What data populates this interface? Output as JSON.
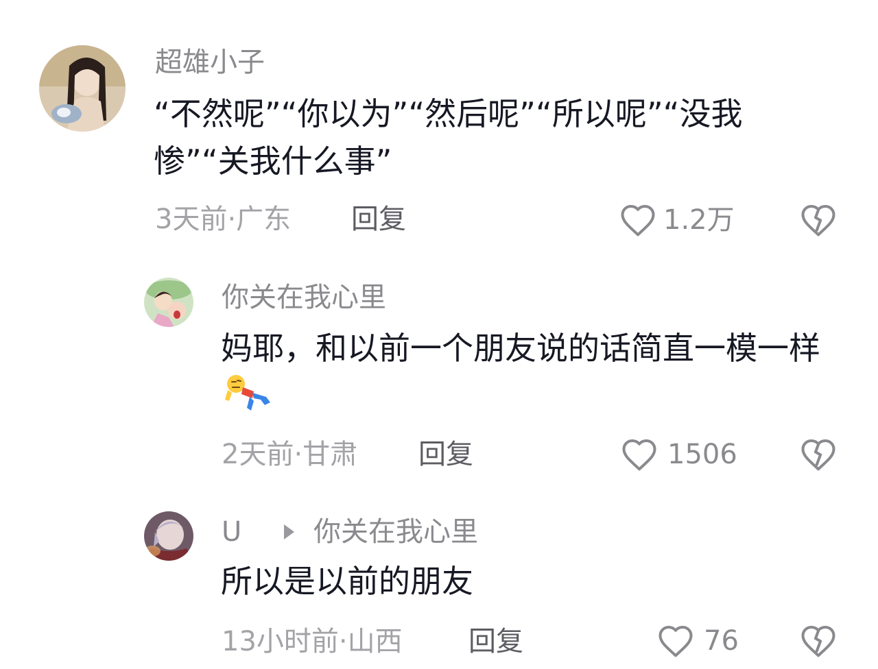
{
  "comments": [
    {
      "username": "超雄小子",
      "text": "“不然呢”“你以为”“然后呢”“所以呢”“没我惨”“关我什么事”",
      "time_location": "3天前·广东",
      "reply_label": "回复",
      "likes": "1.2万"
    },
    {
      "username": "你关在我心里",
      "text": "妈耶，和以前一个朋友说的话简直一模一样",
      "time_location": "2天前·甘肃",
      "reply_label": "回复",
      "likes": "1506"
    },
    {
      "username": "U",
      "reply_to": "你关在我心里",
      "text": "所以是以前的朋友",
      "time_location": "13小时前·山西",
      "reply_label": "回复",
      "likes": "76"
    }
  ],
  "icons": {
    "like": "heart-outline-icon",
    "dislike": "broken-heart-icon",
    "reply_arrow": "triangle-right-icon",
    "emoji": "lying-down-person-emoji"
  },
  "colors": {
    "text": "#161823",
    "secondary": "#8a8a8e",
    "meta": "#a3a3a7"
  }
}
